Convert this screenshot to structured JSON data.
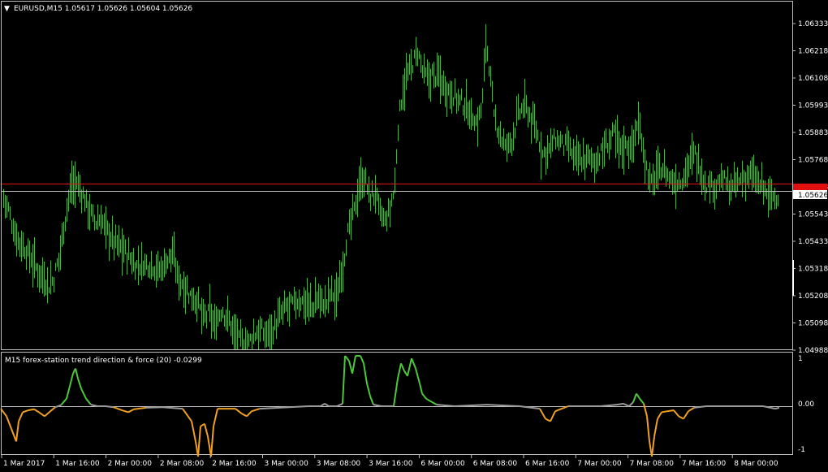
{
  "symbol_header": {
    "text": "EURUSD,M15  1.05617 1.05626 1.05604 1.05626",
    "menu_glyph": "▼"
  },
  "indicator_header": "M15 forex-station trend direction & force (20) -0.0299",
  "price_axis": {
    "ticks": [
      "1.06333",
      "1.06218",
      "1.06108",
      "1.05993",
      "1.05883",
      "1.05768",
      "1.05658",
      "1.05543",
      "1.05433",
      "1.05318",
      "1.05208",
      "1.05098",
      "1.04988"
    ],
    "current_price_label": "1.05626"
  },
  "indicator_axis": {
    "ticks": [
      "1",
      "0.00",
      "-1"
    ]
  },
  "time_axis": {
    "ticks": [
      "1 Mar 2017",
      "1 Mar 16:00",
      "2 Mar 00:00",
      "2 Mar 08:00",
      "2 Mar 16:00",
      "3 Mar 00:00",
      "3 Mar 08:00",
      "3 Mar 16:00",
      "6 Mar 00:00",
      "6 Mar 08:00",
      "6 Mar 16:00",
      "7 Mar 00:00",
      "7 Mar 08:00",
      "7 Mar 16:00",
      "8 Mar 00:00"
    ]
  },
  "colors": {
    "background": "#000000",
    "grid_border": "#c0c0c0",
    "bars": "#4cae44",
    "bid_line": "#c0c0c0",
    "ask_line": "#e01010",
    "ind_up": "#4dc83a",
    "ind_down": "#f0a020",
    "ind_neutral": "#9a9a9a"
  },
  "chart_data": {
    "type": "ohlc_bars",
    "symbol": "EURUSD",
    "timeframe": "M15",
    "last_close": 1.05626,
    "ask_level": 1.05658,
    "ylim": [
      1.04975,
      1.06403
    ],
    "indicator": {
      "name": "forex-station trend direction & force (20)",
      "last_value": -0.0299,
      "ylim": [
        -1,
        1
      ],
      "levels": [
        0.0
      ],
      "approx_values": [
        [
          1,
          -0.05
        ],
        [
          8,
          -0.2
        ],
        [
          14,
          -0.45
        ],
        [
          20,
          -0.7
        ],
        [
          23,
          -0.3
        ],
        [
          28,
          -0.12
        ],
        [
          35,
          -0.08
        ],
        [
          42,
          -0.06
        ],
        [
          48,
          -0.12
        ],
        [
          55,
          -0.2
        ],
        [
          62,
          -0.1
        ],
        [
          68,
          -0.02
        ],
        [
          75,
          0.02
        ],
        [
          82,
          0.15
        ],
        [
          86,
          0.4
        ],
        [
          90,
          0.65
        ],
        [
          93,
          0.75
        ],
        [
          96,
          0.55
        ],
        [
          100,
          0.35
        ],
        [
          106,
          0.15
        ],
        [
          112,
          0.03
        ],
        [
          120,
          0.0
        ],
        [
          130,
          0.0
        ],
        [
          140,
          -0.02
        ],
        [
          150,
          -0.08
        ],
        [
          158,
          -0.12
        ],
        [
          165,
          -0.06
        ],
        [
          180,
          -0.03
        ],
        [
          200,
          -0.02
        ],
        [
          225,
          -0.05
        ],
        [
          236,
          -0.3
        ],
        [
          241,
          -0.7
        ],
        [
          244,
          -1.0
        ],
        [
          247,
          -0.4
        ],
        [
          252,
          -0.35
        ],
        [
          256,
          -0.6
        ],
        [
          260,
          -1.0
        ],
        [
          263,
          -0.4
        ],
        [
          268,
          -0.05
        ],
        [
          290,
          -0.05
        ],
        [
          298,
          -0.15
        ],
        [
          304,
          -0.2
        ],
        [
          310,
          -0.1
        ],
        [
          320,
          -0.05
        ],
        [
          380,
          0.0
        ],
        [
          395,
          0.0
        ],
        [
          400,
          0.05
        ],
        [
          405,
          0.0
        ],
        [
          415,
          0.0
        ],
        [
          422,
          0.05
        ],
        [
          425,
          1.0
        ],
        [
          430,
          0.9
        ],
        [
          434,
          0.65
        ],
        [
          438,
          1.0
        ],
        [
          444,
          1.0
        ],
        [
          448,
          0.85
        ],
        [
          452,
          0.45
        ],
        [
          456,
          0.2
        ],
        [
          460,
          0.03
        ],
        [
          470,
          0.0
        ],
        [
          485,
          0.0
        ],
        [
          490,
          0.55
        ],
        [
          494,
          0.85
        ],
        [
          498,
          0.7
        ],
        [
          502,
          0.6
        ],
        [
          507,
          0.95
        ],
        [
          512,
          0.75
        ],
        [
          517,
          0.45
        ],
        [
          520,
          0.25
        ],
        [
          525,
          0.15
        ],
        [
          530,
          0.1
        ],
        [
          538,
          0.03
        ],
        [
          560,
          0.0
        ],
        [
          600,
          0.03
        ],
        [
          640,
          0.0
        ],
        [
          665,
          -0.05
        ],
        [
          672,
          -0.25
        ],
        [
          678,
          -0.3
        ],
        [
          684,
          -0.1
        ],
        [
          700,
          0.0
        ],
        [
          740,
          0.0
        ],
        [
          760,
          0.03
        ],
        [
          768,
          0.05
        ],
        [
          775,
          0.0
        ],
        [
          780,
          0.08
        ],
        [
          784,
          0.25
        ],
        [
          788,
          0.15
        ],
        [
          793,
          0.05
        ],
        [
          797,
          -0.2
        ],
        [
          800,
          -0.7
        ],
        [
          803,
          -1.0
        ],
        [
          806,
          -0.6
        ],
        [
          810,
          -0.25
        ],
        [
          815,
          -0.12
        ],
        [
          822,
          -0.1
        ],
        [
          830,
          -0.08
        ],
        [
          836,
          -0.2
        ],
        [
          842,
          -0.25
        ],
        [
          848,
          -0.1
        ],
        [
          855,
          -0.03
        ],
        [
          870,
          0.0
        ],
        [
          940,
          0.0
        ],
        [
          955,
          -0.05
        ],
        [
          960,
          -0.03
        ]
      ]
    }
  }
}
